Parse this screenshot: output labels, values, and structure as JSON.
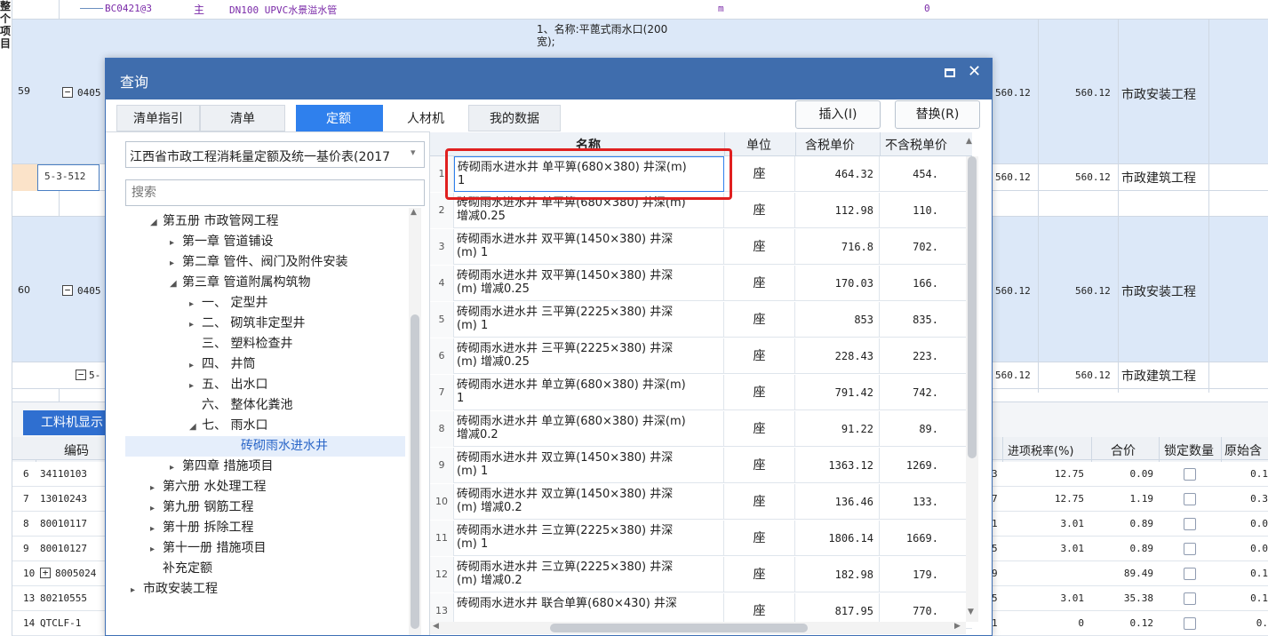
{
  "bg": {
    "top_row": {
      "code": "BC0421@3",
      "type": "主",
      "name": "DN100 UPVC水景溢水管",
      "unit": "m",
      "qty": "0"
    },
    "desc_lines": [
      "1、名称:平蓖式雨水口(200",
      "宽);"
    ],
    "row59": {
      "num": "59",
      "code": "0405",
      "v1": "560.12",
      "v2": "560.12",
      "label": "市政安装工程"
    },
    "sub512": {
      "code": "5-3-512",
      "v1": "560.12",
      "v2": "560.12",
      "label": "市政建筑工程"
    },
    "row60": {
      "num": "60",
      "code": "0405",
      "v1": "560.12",
      "v2": "560.12",
      "label": "市政安装工程"
    },
    "sub60": {
      "code": "5-",
      "v1": "560.12",
      "v2": "560.12",
      "label": "市政建筑工程"
    },
    "side_chars": [
      "整",
      "个",
      "项",
      "目"
    ],
    "bottom_tab": "工料机显示",
    "bottom_head": {
      "code": "编码",
      "tax": "进项税率(%)",
      "total": "合价",
      "lock": "锁定数量",
      "orig": "原始含"
    },
    "bottom_rows": [
      {
        "num": "6",
        "code": "34110103",
        "frag": "3",
        "tax": "12.75",
        "total": "0.09",
        "orig": "0.1"
      },
      {
        "num": "7",
        "code": "13010243",
        "frag": "7",
        "tax": "12.75",
        "total": "1.19",
        "orig": "0.3"
      },
      {
        "num": "8",
        "code": "80010117",
        "frag": "1",
        "tax": "3.01",
        "total": "0.89",
        "orig": "0.0"
      },
      {
        "num": "9",
        "code": "80010127",
        "frag": "5",
        "tax": "3.01",
        "total": "0.89",
        "orig": "0.0"
      },
      {
        "num": "10",
        "code": "8005024",
        "frag": "9",
        "tax": "",
        "total": "89.49",
        "orig": "0.1"
      },
      {
        "num": "13",
        "code": "80210555",
        "frag": "5",
        "tax": "3.01",
        "total": "35.38",
        "orig": "0.1"
      },
      {
        "num": "14",
        "code": "QTCLF-1",
        "frag": "1",
        "tax": "0",
        "total": "0.12",
        "orig": "0."
      }
    ]
  },
  "dialog": {
    "title": "查询",
    "tabs": [
      "清单指引",
      "清单",
      "定额",
      "人材机",
      "我的数据"
    ],
    "insert_label": "插入(I)",
    "replace_label": "替换(R)",
    "library": "江西省市政工程消耗量定额及统一基价表(2017",
    "search_placeholder": "搜索",
    "tree": [
      {
        "label": "第五册 市政管网工程",
        "indent": 1,
        "arrow": "◢"
      },
      {
        "label": "第一章 管道铺设",
        "indent": 2,
        "arrow": "▸"
      },
      {
        "label": "第二章 管件、阀门及附件安装",
        "indent": 2,
        "arrow": "▸"
      },
      {
        "label": "第三章 管道附属构筑物",
        "indent": 2,
        "arrow": "◢"
      },
      {
        "label": "一、 定型井",
        "indent": 3,
        "arrow": "▸"
      },
      {
        "label": "二、 砌筑非定型井",
        "indent": 3,
        "arrow": "▸"
      },
      {
        "label": "三、 塑料检查井",
        "indent": 3,
        "arrow": ""
      },
      {
        "label": "四、 井筒",
        "indent": 3,
        "arrow": "▸"
      },
      {
        "label": "五、 出水口",
        "indent": 3,
        "arrow": "▸"
      },
      {
        "label": "六、 整体化粪池",
        "indent": 3,
        "arrow": ""
      },
      {
        "label": "七、 雨水口",
        "indent": 3,
        "arrow": "◢"
      },
      {
        "label": "砖砌雨水进水井",
        "indent": 4,
        "arrow": "",
        "selected": true
      },
      {
        "label": "第四章 措施项目",
        "indent": 2,
        "arrow": "▸"
      },
      {
        "label": "第六册 水处理工程",
        "indent": 1,
        "arrow": "▸"
      },
      {
        "label": "第九册 钢筋工程",
        "indent": 1,
        "arrow": "▸"
      },
      {
        "label": "第十册 拆除工程",
        "indent": 1,
        "arrow": "▸"
      },
      {
        "label": "第十一册 措施项目",
        "indent": 1,
        "arrow": "▸"
      },
      {
        "label": "补充定额",
        "indent": 1,
        "arrow": ""
      },
      {
        "label": "市政安装工程",
        "indent": 0,
        "arrow": "▸"
      }
    ],
    "columns": {
      "name": "名称",
      "unit": "单位",
      "p_tax": "含税单价",
      "p_notax": "不含税单价"
    },
    "rows": [
      {
        "n": "1",
        "l1": "砖砌雨水进水井 单平箅(680×380) 井深(m)",
        "l2": "1",
        "unit": "座",
        "p1": "464.32",
        "p2": "454."
      },
      {
        "n": "2",
        "l1": "砖砌雨水进水井 单平箅(680×380) 井深(m)",
        "l2": "增减0.25",
        "unit": "座",
        "p1": "112.98",
        "p2": "110."
      },
      {
        "n": "3",
        "l1": "砖砌雨水进水井 双平箅(1450×380) 井深",
        "l2": "(m) 1",
        "unit": "座",
        "p1": "716.8",
        "p2": "702."
      },
      {
        "n": "4",
        "l1": "砖砌雨水进水井 双平箅(1450×380) 井深",
        "l2": "(m) 增减0.25",
        "unit": "座",
        "p1": "170.03",
        "p2": "166."
      },
      {
        "n": "5",
        "l1": "砖砌雨水进水井 三平箅(2225×380) 井深",
        "l2": "(m) 1",
        "unit": "座",
        "p1": "853",
        "p2": "835."
      },
      {
        "n": "6",
        "l1": "砖砌雨水进水井 三平箅(2225×380) 井深",
        "l2": "(m) 增减0.25",
        "unit": "座",
        "p1": "228.43",
        "p2": "223."
      },
      {
        "n": "7",
        "l1": "砖砌雨水进水井 单立箅(680×380) 井深(m)",
        "l2": "1",
        "unit": "座",
        "p1": "791.42",
        "p2": "742."
      },
      {
        "n": "8",
        "l1": "砖砌雨水进水井 单立箅(680×380) 井深(m)",
        "l2": "增减0.2",
        "unit": "座",
        "p1": "91.22",
        "p2": "89."
      },
      {
        "n": "9",
        "l1": "砖砌雨水进水井 双立箅(1450×380) 井深",
        "l2": "(m) 1",
        "unit": "座",
        "p1": "1363.12",
        "p2": "1269."
      },
      {
        "n": "10",
        "l1": "砖砌雨水进水井 双立箅(1450×380) 井深",
        "l2": "(m) 增减0.2",
        "unit": "座",
        "p1": "136.46",
        "p2": "133."
      },
      {
        "n": "11",
        "l1": "砖砌雨水进水井 三立箅(2225×380) 井深",
        "l2": "(m) 1",
        "unit": "座",
        "p1": "1806.14",
        "p2": "1669."
      },
      {
        "n": "12",
        "l1": "砖砌雨水进水井 三立箅(2225×380) 井深",
        "l2": "(m) 增减0.2",
        "unit": "座",
        "p1": "182.98",
        "p2": "179."
      },
      {
        "n": "13",
        "l1": "砖砌雨水进水井 联合单箅(680×430) 井深",
        "l2": "",
        "unit": "座",
        "p1": "817.95",
        "p2": "770."
      }
    ],
    "colors": {
      "title_bar": "#3f6dad",
      "active_tab": "#2f80ed",
      "highlight": "#e02020",
      "selected_row": "#e5eefb"
    }
  }
}
